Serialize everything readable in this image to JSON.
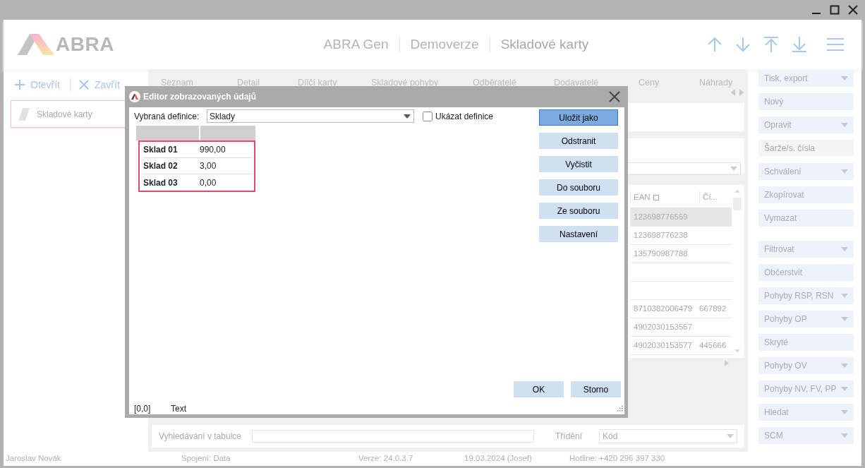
{
  "header": {
    "logo_text": "ABRA",
    "breadcrumbs": [
      "ABRA Gen",
      "Demoverze",
      "Skladové karty"
    ]
  },
  "actions": [
    {
      "label": "Otevřít",
      "kind": "open"
    },
    {
      "label": "Zavřít",
      "kind": "close"
    }
  ],
  "open_cards": [
    {
      "label": "Skladové karty"
    }
  ],
  "tabs": [
    "Seznam",
    "Detail",
    "Dílčí karty",
    "Skladové pohyby",
    "Odběratelé",
    "Dodavatelé",
    "Ceny",
    "Náhrady"
  ],
  "table": {
    "columns": [
      "EAN",
      "Čí..."
    ],
    "rows": [
      {
        "ean": "123698776559",
        "selected": true
      },
      {
        "ean": "123698776238",
        "selected": false
      },
      {
        "ean": "135790987788",
        "selected": false
      },
      {
        "selected": false
      },
      {
        "selected": false
      },
      {
        "ean": "8710382006479",
        "column_2": "667892",
        "selected": false
      },
      {
        "ean": "4902030153557",
        "selected": false
      },
      {
        "ean": "4902030153577",
        "column_2": "445666",
        "selected": false
      }
    ]
  },
  "search": {
    "label": "Vyhledávání v tabulce",
    "sort_label": "Třídění",
    "sort_value": "Kód"
  },
  "sidebar": {
    "groups": [
      [
        {
          "label": "Tisk, export",
          "kind": "dropdown",
          "disabled": false
        },
        {
          "label": "Nový",
          "kind": "button",
          "disabled": false
        },
        {
          "label": "Opravit",
          "kind": "dropdown",
          "disabled": false
        },
        {
          "label": "Šarže/s. čísla",
          "kind": "button",
          "disabled": true
        },
        {
          "label": "Schválení",
          "kind": "dropdown",
          "disabled": false
        },
        {
          "label": "Zkopírovat",
          "kind": "button",
          "disabled": false
        },
        {
          "label": "Vymazat",
          "kind": "button",
          "disabled": false
        }
      ],
      [
        {
          "label": "Filtrovat",
          "kind": "dropdown",
          "disabled": false
        },
        {
          "label": "Občerstvit",
          "kind": "button",
          "disabled": false
        },
        {
          "label": "Pohyby RSP, RSN",
          "kind": "dropdown",
          "disabled": false
        },
        {
          "label": "Pohyby OP",
          "kind": "dropdown",
          "disabled": false
        },
        {
          "label": "Skryté",
          "kind": "button",
          "disabled": false
        },
        {
          "label": "Pohyby OV",
          "kind": "dropdown",
          "disabled": false
        },
        {
          "label": "Pohyby NV, FV, PP",
          "kind": "dropdown",
          "disabled": false
        },
        {
          "label": "Hledat",
          "kind": "dropdown",
          "disabled": false
        },
        {
          "label": "SCM",
          "kind": "dropdown",
          "disabled": false
        }
      ]
    ]
  },
  "status_bar": [
    "Jaroslav Novák",
    "Spojení: Data",
    "Verze: 24.0.3.7",
    "19.03.2024 (Josef)",
    "Hotline: +420 296 397 330"
  ],
  "dialog": {
    "title": "Editor zobrazovaných údajů",
    "definition_label": "Vybraná definice:",
    "definition_value": "Sklady",
    "show_definitions": {
      "label": "Ukázat definice",
      "checked": false
    },
    "rows": [
      {
        "name": "Sklad 01",
        "value": "990,00"
      },
      {
        "name": "Sklad 02",
        "value": "3,00"
      },
      {
        "name": "Sklad 03",
        "value": "0,00"
      }
    ],
    "buttons": [
      {
        "label": "Uložit jako",
        "default": true
      },
      {
        "label": "Odstranit",
        "default": false
      },
      {
        "label": "Vyčistit",
        "default": false
      },
      {
        "label": "Do souboru",
        "default": false
      },
      {
        "label": "Ze souboru",
        "default": false
      },
      {
        "label": "Nastavení",
        "default": false
      }
    ],
    "ok": "OK",
    "cancel": "Storno",
    "status": {
      "position": "[0,0]",
      "text": "Text"
    }
  }
}
